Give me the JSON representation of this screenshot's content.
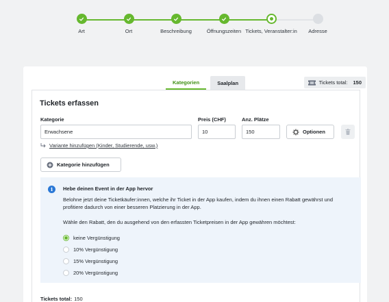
{
  "stepper": {
    "steps": [
      {
        "label": "Art",
        "state": "done"
      },
      {
        "label": "Ort",
        "state": "done"
      },
      {
        "label": "Beschreibung",
        "state": "done"
      },
      {
        "label": "Öffnungszeiten",
        "state": "done"
      },
      {
        "label": "Tickets, Veranstalter:in",
        "state": "current"
      },
      {
        "label": "Adresse",
        "state": "todo"
      }
    ]
  },
  "tabs": {
    "categories": "Kategorien",
    "seating_plan": "Saalplan"
  },
  "tickets_badge": {
    "label": "Tickets total:",
    "value": "150"
  },
  "section": {
    "title": "Tickets erfassen",
    "category_label": "Kategorie",
    "price_label": "Preis (CHF)",
    "seats_label": "Anz. Plätze",
    "category_value": "Erwachsene",
    "price_value": "10",
    "seats_value": "150",
    "options_button": "Optionen",
    "add_variant_link": "Variante hinzufügen (Kinder, Studierende, usw.)",
    "add_category_button": "Kategorie hinzufügen"
  },
  "promo": {
    "title": "Hebe deinen Event in der App hervor",
    "text": "Belohne jetzt deine Ticketkäufer:innen, welche ihr Ticket in der App kaufen, indem du ihnen einen Rabatt gewährst und profitiere dadurch von einer besseren Platzierung in der App.",
    "question": "Wähle den Rabatt, den du ausgehend von den erfassten Ticketpreisen in der App gewähren möchtest:",
    "options": [
      {
        "label": "keine Vergünstigung",
        "checked": true
      },
      {
        "label": "10% Vergünstigung",
        "checked": false
      },
      {
        "label": "15% Vergünstigung",
        "checked": false
      },
      {
        "label": "20% Vergünstigung",
        "checked": false
      }
    ]
  },
  "footer": {
    "total_label": "Tickets total:",
    "total_value": "150"
  },
  "colors": {
    "accent": "#66b82e",
    "info": "#2a78d6",
    "promo_bg": "#eef4fb"
  }
}
